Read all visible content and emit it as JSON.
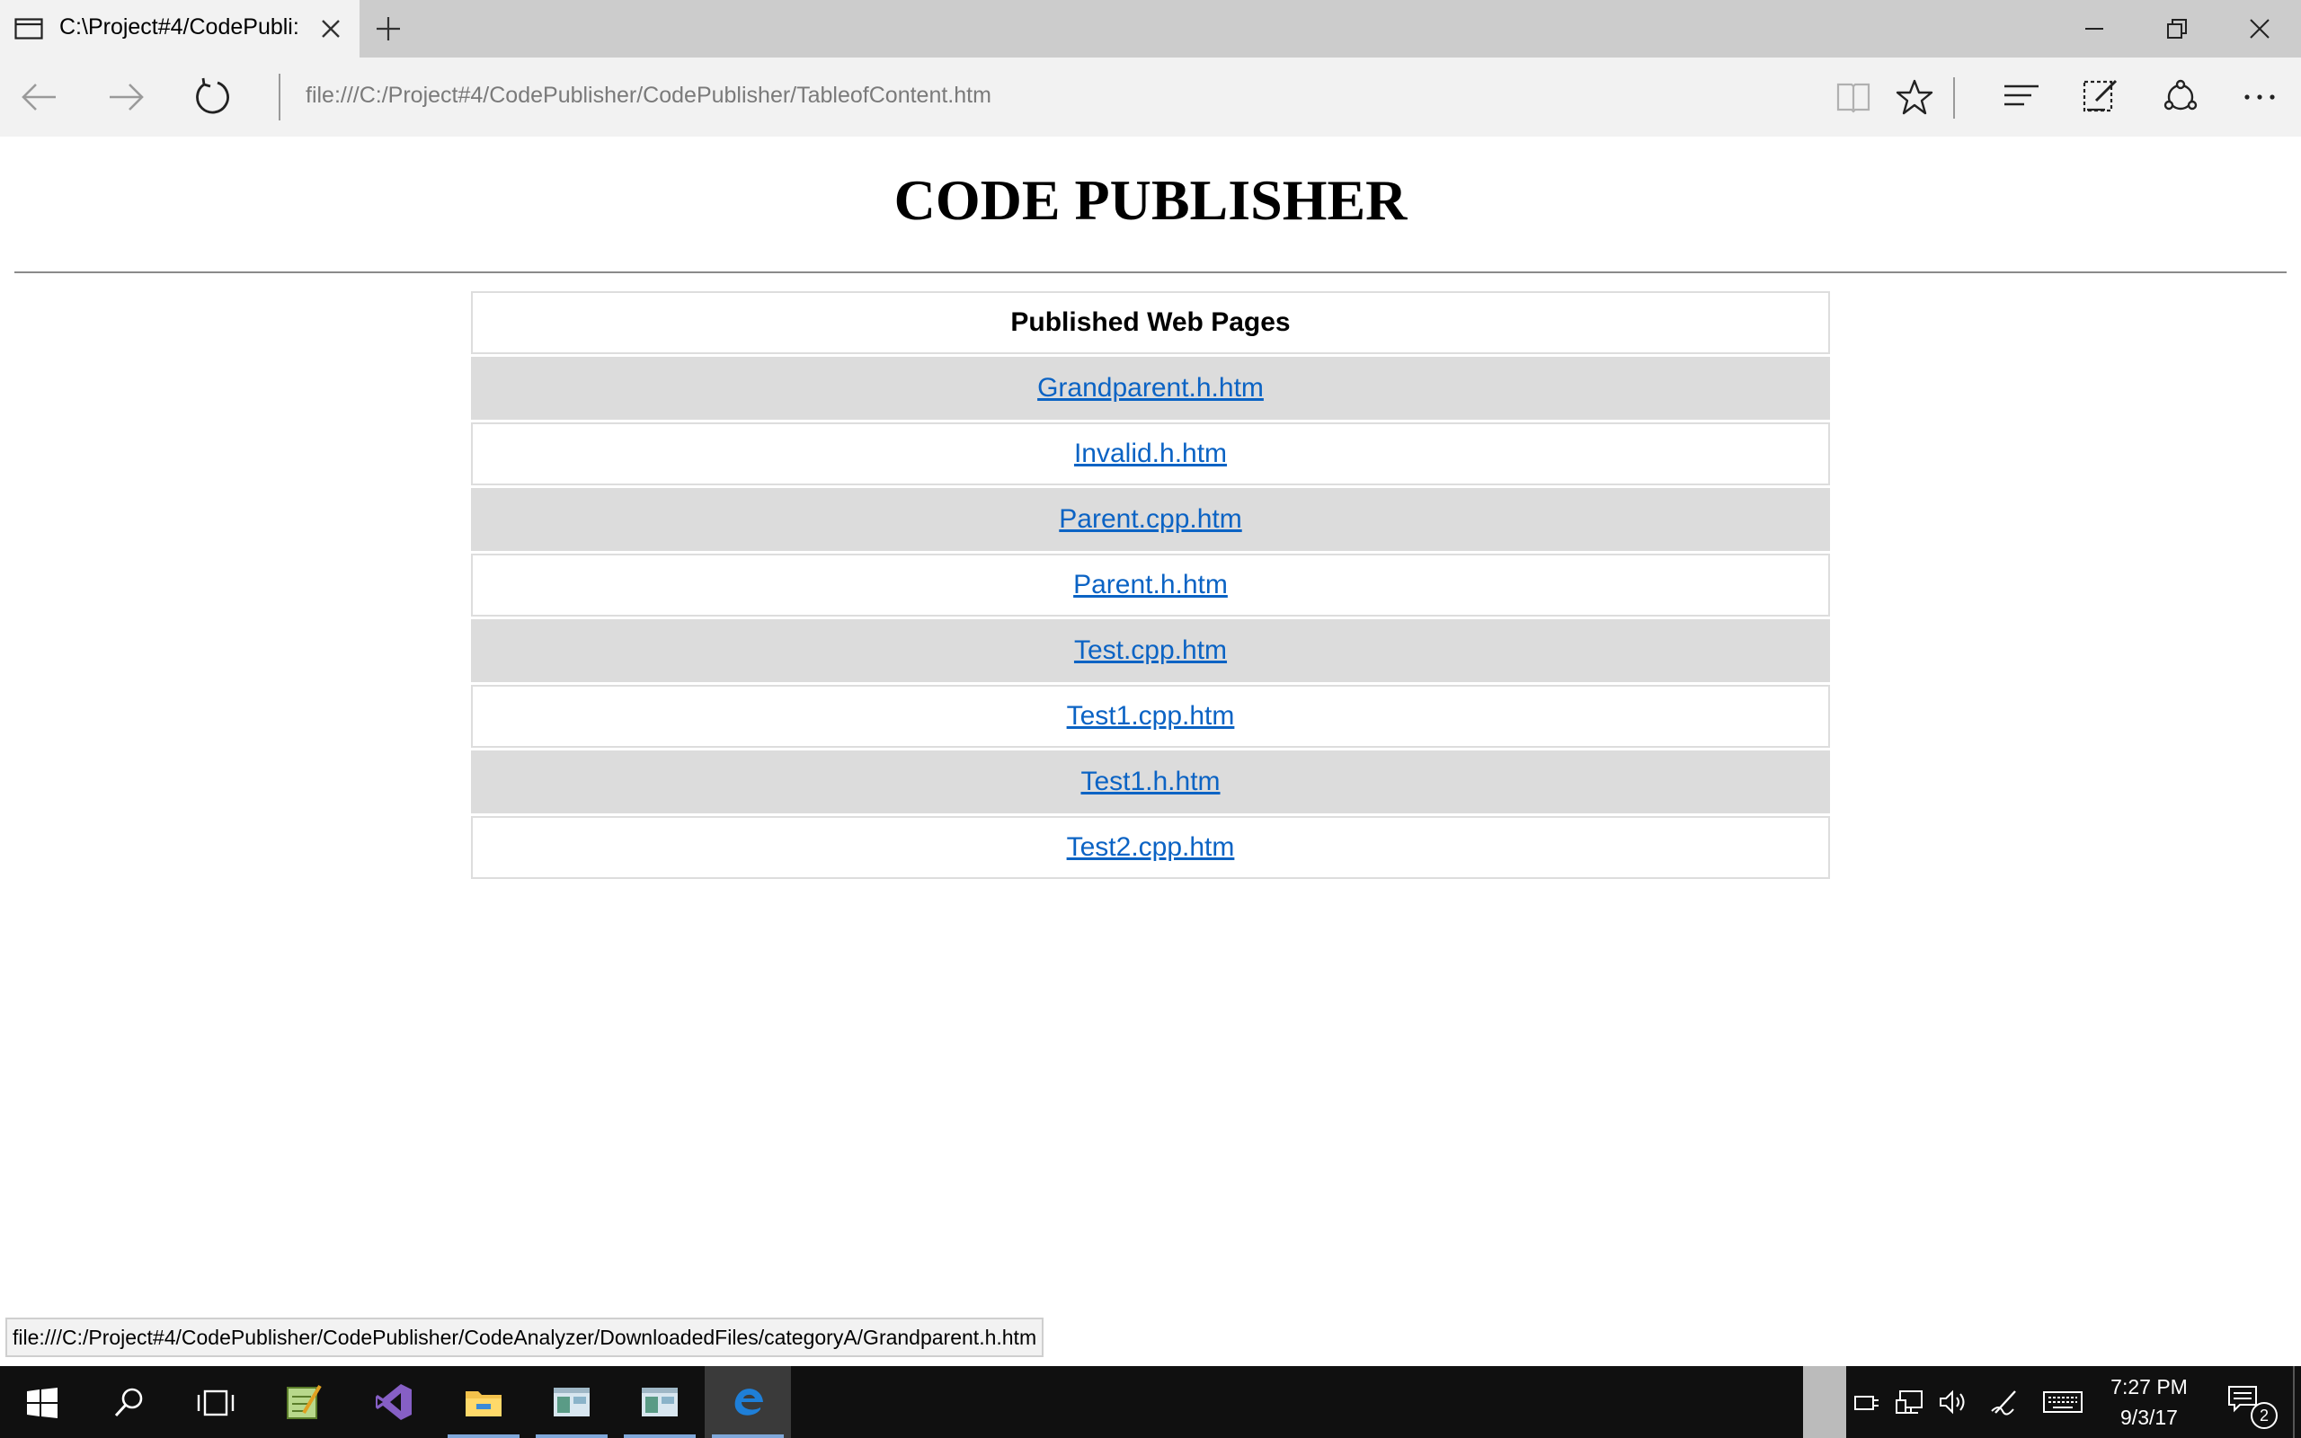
{
  "browser": {
    "tab_title": "C:\\Project#4/CodePubli:",
    "address": "file:///C:/Project#4/CodePublisher/CodePublisher/TableofContent.htm"
  },
  "page": {
    "title": "CODE PUBLISHER",
    "table_header": "Published Web Pages",
    "links": [
      "Grandparent.h.htm",
      "Invalid.h.htm",
      "Parent.cpp.htm",
      "Parent.h.htm",
      "Test.cpp.htm",
      "Test1.cpp.htm",
      "Test1.h.htm",
      "Test2.cpp.htm"
    ]
  },
  "status_bar": {
    "hover_url": "file:///C:/Project#4/CodePublisher/CodePublisher/CodeAnalyzer/DownloadedFiles/categoryA/Grandparent.h.htm"
  },
  "taskbar": {
    "time": "7:27 PM",
    "date": "9/3/17",
    "notification_count": "2"
  },
  "colors": {
    "link": "#0b63c4",
    "row_alt": "#dcdcdc",
    "taskbar": "#101010",
    "edge_accent": "#1e7fd8"
  }
}
